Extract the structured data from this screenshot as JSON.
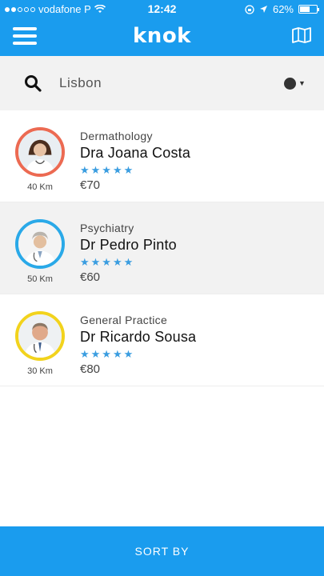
{
  "status_bar": {
    "carrier": "vodafone P",
    "time": "12:42",
    "battery_percent": "62%",
    "battery_level": 0.62,
    "signal_bars_filled": 2,
    "signal_bars_total": 5,
    "icons": [
      "wifi-icon",
      "rotation-lock-icon",
      "location-arrow-icon",
      "battery-icon"
    ]
  },
  "header": {
    "logo": "knok",
    "menu_icon": "hamburger-menu-icon",
    "map_icon": "map-icon",
    "color": "#1a9cee"
  },
  "search": {
    "value": "Lisbon",
    "icon": "search-icon"
  },
  "doctors": [
    {
      "specialty": "Dermathology",
      "name": "Dra Joana Costa",
      "rating_stars": "★★★★★",
      "rating": 5,
      "price": "€70",
      "distance": "40 Km",
      "ring_color": "#ec6a52"
    },
    {
      "specialty": "Psychiatry",
      "name": "Dr Pedro Pinto",
      "rating_stars": "★★★★★",
      "rating": 5,
      "price": "€60",
      "distance": "50 Km",
      "ring_color": "#2aa9e8"
    },
    {
      "specialty": "General Practice",
      "name": "Dr Ricardo Sousa",
      "rating_stars": "★★★★★",
      "rating": 5,
      "price": "€80",
      "distance": "30 Km",
      "ring_color": "#f2d31d"
    }
  ],
  "footer": {
    "sort_label": "SORT BY"
  }
}
